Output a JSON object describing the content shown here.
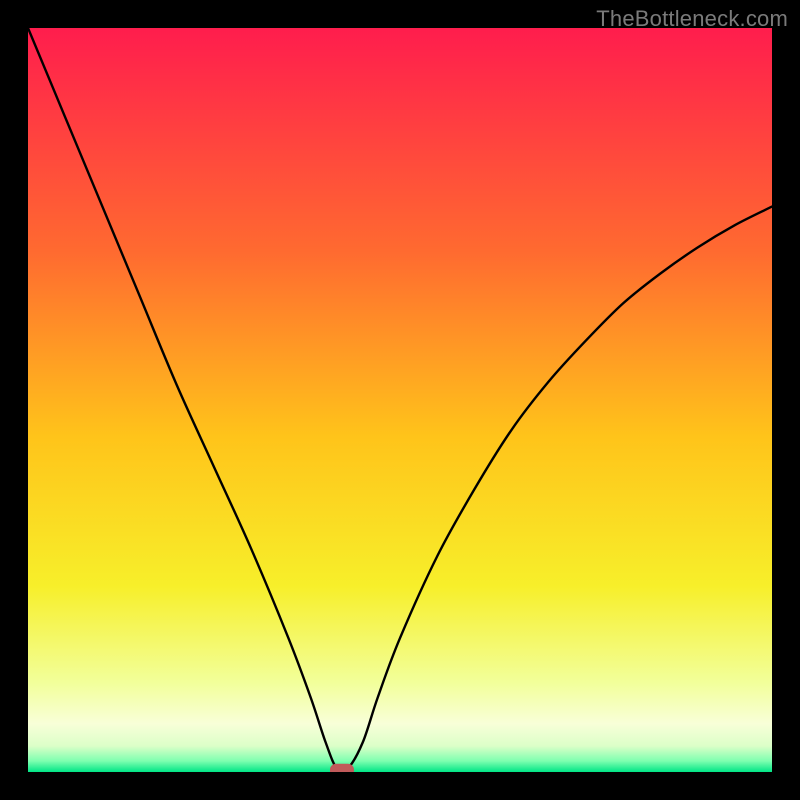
{
  "watermark": "TheBottleneck.com",
  "chart_data": {
    "type": "line",
    "title": "",
    "xlabel": "",
    "ylabel": "",
    "xlim": [
      0,
      100
    ],
    "ylim": [
      0,
      100
    ],
    "series": [
      {
        "name": "bottleneck-curve",
        "x": [
          0,
          5,
          10,
          15,
          20,
          25,
          30,
          35,
          38,
          40,
          41.5,
          43,
          45,
          47,
          50,
          55,
          60,
          65,
          70,
          75,
          80,
          85,
          90,
          95,
          100
        ],
        "y": [
          100,
          88,
          76,
          64,
          52,
          41,
          30,
          18,
          10,
          4,
          0.5,
          0.5,
          4,
          10,
          18,
          29,
          38,
          46,
          52.5,
          58,
          63,
          67,
          70.5,
          73.5,
          76
        ]
      }
    ],
    "marker": {
      "x": 42.2,
      "y": 0.3,
      "color": "#c05a5a"
    },
    "gradient_stops": [
      {
        "offset": 0.0,
        "color": "#ff1d4d"
      },
      {
        "offset": 0.3,
        "color": "#ff6a30"
      },
      {
        "offset": 0.55,
        "color": "#ffc41a"
      },
      {
        "offset": 0.75,
        "color": "#f7ef2a"
      },
      {
        "offset": 0.88,
        "color": "#f2ff9a"
      },
      {
        "offset": 0.935,
        "color": "#f8ffd8"
      },
      {
        "offset": 0.965,
        "color": "#dcffc8"
      },
      {
        "offset": 0.985,
        "color": "#7fffb0"
      },
      {
        "offset": 1.0,
        "color": "#00e586"
      }
    ]
  }
}
